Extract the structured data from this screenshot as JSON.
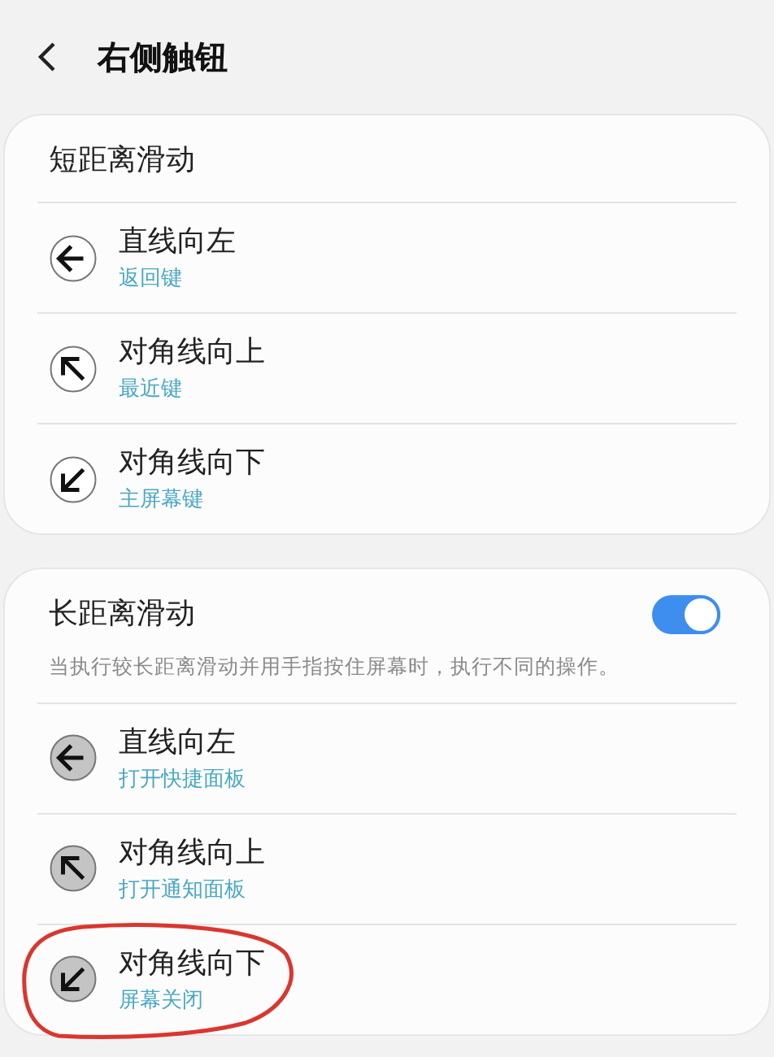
{
  "header": {
    "title": "右侧触钮"
  },
  "sections": [
    {
      "title": "短距离滑动",
      "items": [
        {
          "kind": "left",
          "title": "直线向左",
          "action": "返回键",
          "highlighted": false
        },
        {
          "kind": "upleft",
          "title": "对角线向上",
          "action": "最近键",
          "highlighted": false
        },
        {
          "kind": "downleft",
          "title": "对角线向下",
          "action": "主屏幕键",
          "highlighted": false
        }
      ]
    },
    {
      "title": "长距离滑动",
      "toggle": {
        "on": true
      },
      "description": "当执行较长距离滑动并用手指按住屏幕时，执行不同的操作。",
      "items": [
        {
          "kind": "left",
          "title": "直线向左",
          "action": "打开快捷面板",
          "highlighted": false
        },
        {
          "kind": "upleft",
          "title": "对角线向上",
          "action": "打开通知面板",
          "highlighted": false
        },
        {
          "kind": "downleft",
          "title": "对角线向下",
          "action": "屏幕关闭",
          "highlighted": true
        }
      ]
    }
  ]
}
